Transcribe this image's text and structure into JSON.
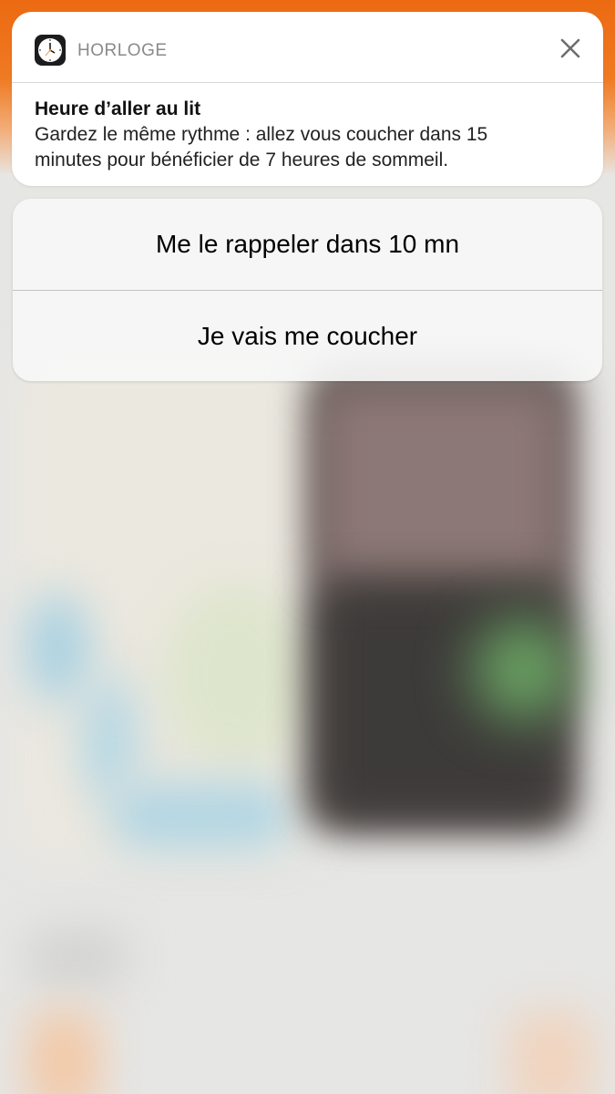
{
  "notification": {
    "app_name": "HORLOGE",
    "app_icon": "clock-icon",
    "close_icon": "close-icon",
    "title": "Heure d’aller au lit",
    "body_line1": "Gardez le même rythme : allez vous coucher dans 15",
    "body_line2": "minutes pour bénéficier de 7 heures de sommeil."
  },
  "actions": {
    "snooze_label": "Me le rappeler dans 10 mn",
    "go_to_bed_label": "Je vais me coucher"
  },
  "colors": {
    "accent_orange": "#ec6a12",
    "card_background": "#ffffff",
    "header_text": "#8a8a8e"
  }
}
